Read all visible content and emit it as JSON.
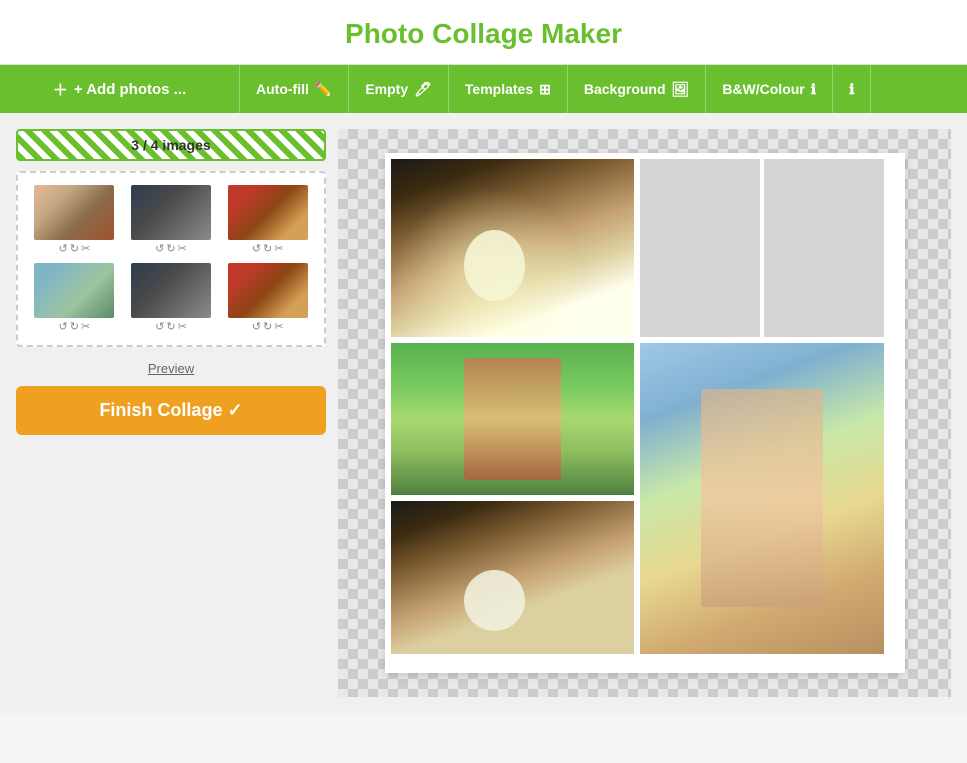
{
  "header": {
    "title": "Photo Collage Maker"
  },
  "toolbar": {
    "add_photos_label": "+ Add photos ...",
    "autofill_label": "Auto-fill",
    "empty_label": "Empty",
    "templates_label": "Templates",
    "background_label": "Background",
    "bwcolour_label": "B&W/Colour",
    "info_label": "ℹ"
  },
  "left_panel": {
    "images_badge": "3 / 4 images",
    "preview_label": "Preview",
    "finish_label": "Finish Collage ✓"
  },
  "thumbnails": [
    {
      "id": "thumb1",
      "class": "photo1"
    },
    {
      "id": "thumb2",
      "class": "photo2"
    },
    {
      "id": "thumb3",
      "class": "photo3"
    },
    {
      "id": "thumb4",
      "class": "photo4"
    },
    {
      "id": "thumb5",
      "class": "photo5"
    },
    {
      "id": "thumb6",
      "class": "photo6"
    }
  ],
  "thumb_controls": "↺ ↻ ✂"
}
